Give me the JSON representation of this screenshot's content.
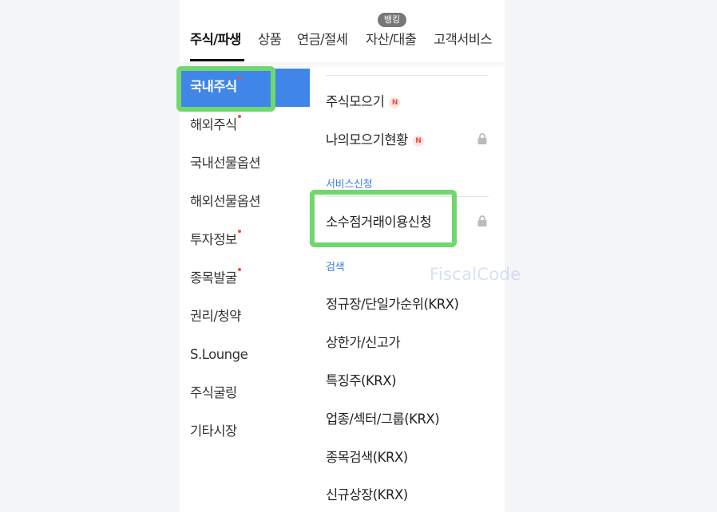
{
  "nav": {
    "tabs": [
      {
        "label": "주식/파생",
        "active": true
      },
      {
        "label": "상품"
      },
      {
        "label": "연금/절세"
      },
      {
        "label": "자산/대출"
      },
      {
        "label": "고객서비스"
      }
    ],
    "banking_badge": "뱅킹"
  },
  "left_menu": {
    "items": [
      {
        "label": "국내주식",
        "new_dot": true,
        "selected": true
      },
      {
        "label": "해외주식",
        "new_dot": true
      },
      {
        "label": "국내선물옵션"
      },
      {
        "label": "해외선물옵션"
      },
      {
        "label": "투자정보",
        "new_dot": true
      },
      {
        "label": "종목발굴",
        "new_dot": true
      },
      {
        "label": "권리/청약"
      },
      {
        "label": "S.Lounge"
      },
      {
        "label": "주식굴링"
      },
      {
        "label": "기타시장"
      }
    ]
  },
  "right_menu": {
    "items": [
      {
        "label": "주식모으기",
        "badge": "N"
      },
      {
        "label": "나의모으기현황",
        "badge": "N",
        "locked": true
      }
    ],
    "service_section": {
      "title": "서비스신청",
      "items": [
        {
          "label": "소수점거래이용신청",
          "locked": true
        }
      ]
    },
    "search_section": {
      "title": "검색",
      "items": [
        {
          "label": "정규장/단일가순위(KRX)"
        },
        {
          "label": "상한가/신고가"
        },
        {
          "label": "특징주(KRX)"
        },
        {
          "label": "업종/섹터/그룹(KRX)"
        },
        {
          "label": "종목검색(KRX)"
        },
        {
          "label": "신규상장(KRX)"
        }
      ]
    }
  },
  "watermark": "FiscalCode",
  "colors": {
    "selected_bg": "#3f86e8",
    "highlight": "#6fd86c",
    "section_title": "#3f7ee0",
    "new_dot": "#f04e3e"
  }
}
